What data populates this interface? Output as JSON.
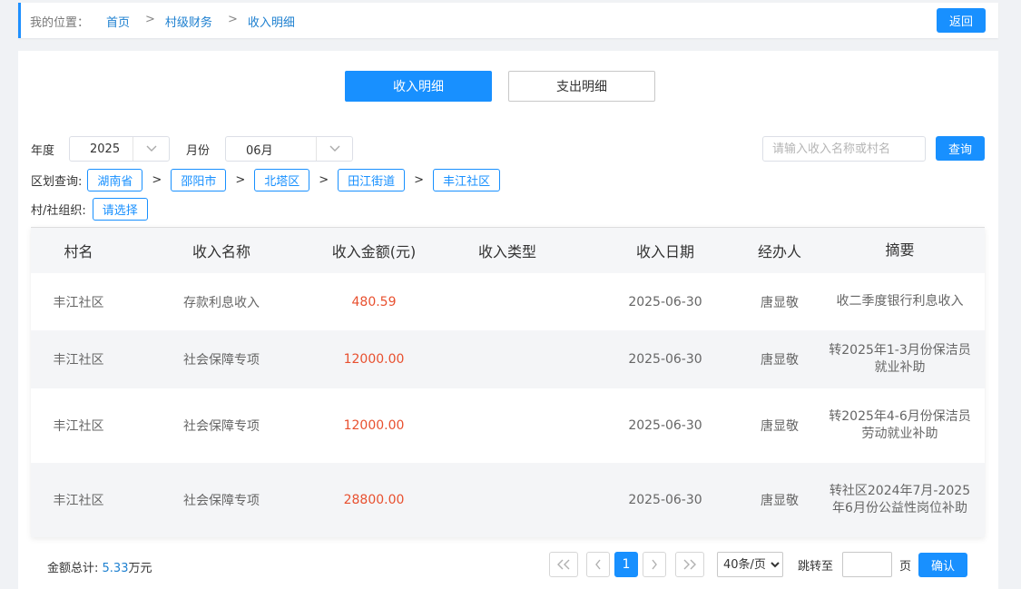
{
  "breadcrumb": {
    "label": "我的位置：",
    "items": [
      "首页",
      "村级财务",
      "收入明细"
    ],
    "separator": ">",
    "back_label": "返回"
  },
  "tabs": [
    {
      "label": "收入明细",
      "active": true
    },
    {
      "label": "支出明细",
      "active": false
    }
  ],
  "filters": {
    "year_label": "年度",
    "year_value": "2025",
    "month_label": "月份",
    "month_value": "06月",
    "search_placeholder": "请输入收入名称或村名",
    "query_label": "查询",
    "region_label": "区划查询:",
    "regions": [
      "湖南省",
      "邵阳市",
      "北塔区",
      "田江街道",
      "丰江社区"
    ],
    "region_separator": ">",
    "org_label": "村/社组织:",
    "org_button": "请选择"
  },
  "table": {
    "headers": [
      "村名",
      "收入名称",
      "收入金额(元)",
      "收入类型",
      "收入日期",
      "经办人",
      "摘要"
    ],
    "rows": [
      {
        "village": "丰江社区",
        "name": "存款利息收入",
        "amount": "480.59",
        "type": "",
        "date": "2025-06-30",
        "handler": "唐显敬",
        "summary": "收二季度银行利息收入"
      },
      {
        "village": "丰江社区",
        "name": "社会保障专项",
        "amount": "12000.00",
        "type": "",
        "date": "2025-06-30",
        "handler": "唐显敬",
        "summary": "转2025年1-3月份保洁员就业补助"
      },
      {
        "village": "丰江社区",
        "name": "社会保障专项",
        "amount": "12000.00",
        "type": "",
        "date": "2025-06-30",
        "handler": "唐显敬",
        "summary": "转2025年4-6月份保洁员劳动就业补助"
      },
      {
        "village": "丰江社区",
        "name": "社会保障专项",
        "amount": "28800.00",
        "type": "",
        "date": "2025-06-30",
        "handler": "唐显敬",
        "summary": "转社区2024年7月-2025年6月份公益性岗位补助"
      }
    ]
  },
  "footer": {
    "total_label": "金额总计:",
    "total_value": "5.33",
    "total_unit": "万元",
    "first_icon": "double-chevron-left-icon",
    "prev_icon": "chevron-left-icon",
    "current_page": "1",
    "next_icon": "chevron-right-icon",
    "last_icon": "double-chevron-right-icon",
    "page_size": "40条/页",
    "jump_label": "跳转至",
    "page_unit": "页",
    "confirm_label": "确认"
  },
  "colors": {
    "accent": "#1890ff",
    "amount": "#e8502f",
    "link": "#1e80d0"
  }
}
